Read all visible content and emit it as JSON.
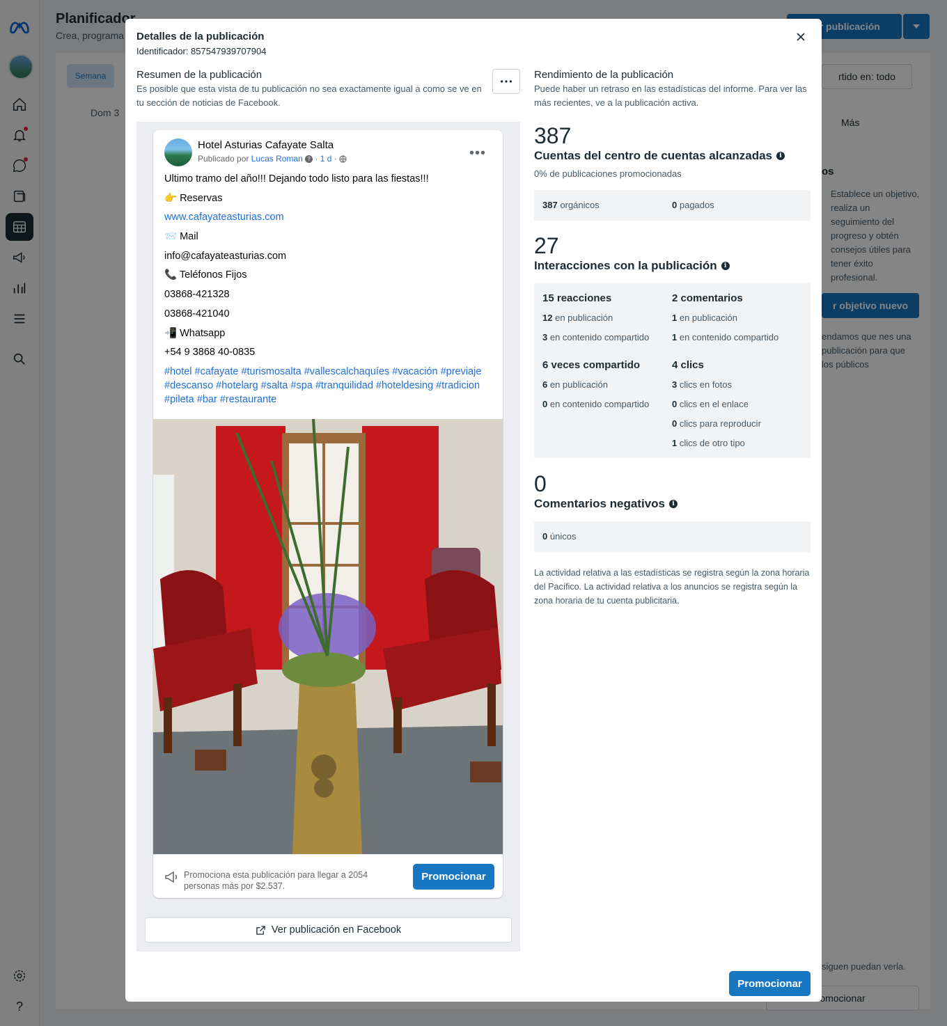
{
  "background": {
    "title": "Planificador",
    "subtitle": "Crea, programa",
    "create_button": "ear publicación",
    "week_button": "Semana",
    "day_label": "Dom 3",
    "filter_label": "rtido en: todo",
    "more_label": "Más",
    "goal_heading": "os",
    "goal_text": "Establece un objetivo, realiza un seguimiento del progreso y obtén consejos útiles para tener éxito profesional.",
    "goal_button": "r objetivo nuevo",
    "recommend_text": "endamos que nes una publicación para que los públicos",
    "side_bottom_text": "siguen puedan verla.",
    "side_bottom_button": "omocionar"
  },
  "modal": {
    "title": "Detalles de la publicación",
    "identifier": "Identificador: 857547939707904",
    "summary_title": "Resumen de la publicación",
    "summary_desc": "Es posible que esta vista de tu publicación no sea exactamente igual a como se ve en tu sección de noticias de Facebook.",
    "performance_title": "Rendimiento de la publicación",
    "performance_desc": "Puede haber un retraso en las estadísticas del informe. Para ver las más recientes, ve a la publicación activa.",
    "view_on_facebook": "Ver publicación en Facebook",
    "promote_button": "Promocionar"
  },
  "post": {
    "page_name": "Hotel Asturias Cafayate Salta",
    "published_by": "Publicado por",
    "author": "Lucas Roman",
    "time": "1 d",
    "lines": [
      "Ultimo tramo del año!!! Dejando todo listo para las fiestas!!!",
      "👉 Reservas",
      "www.cafayateasturias.com",
      "📨 Mail",
      "info@cafayateasturias.com",
      "📞 Teléfonos Fijos",
      "03868-421328",
      "03868-421040",
      "📲 Whatsapp",
      "+54 9 3868 40-0835"
    ],
    "hashtags": "#hotel #cafayate #turismosalta #vallescalchaquíes #vacación #previaje #descanso #hotelarg #salta #spa #tranquilidad #hoteldesing #tradicion #pileta #bar #restaurante",
    "promo_text": "Promociona esta publicación para llegar a 2054 personas más por $2.537.",
    "promo_button": "Promocionar"
  },
  "metrics": {
    "reach": {
      "value": "387",
      "label": "Cuentas del centro de cuentas alcanzadas",
      "promoted_note": "0% de publicaciones promocionadas",
      "organic_value": "387",
      "organic_label": "orgánicos",
      "paid_value": "0",
      "paid_label": "pagados"
    },
    "interactions": {
      "value": "27",
      "label": "Interacciones con la publicación",
      "reactions_title": "15 reacciones",
      "reactions_post_value": "12",
      "reactions_post_label": "en publicación",
      "reactions_shared_value": "3",
      "reactions_shared_label": "en contenido compartido",
      "comments_title": "2 comentarios",
      "comments_post_value": "1",
      "comments_post_label": "en publicación",
      "comments_shared_value": "1",
      "comments_shared_label": "en contenido compartido",
      "shares_title": "6 veces compartido",
      "shares_post_value": "6",
      "shares_post_label": "en publicación",
      "shares_shared_value": "0",
      "shares_shared_label": "en contenido compartido",
      "clicks_title": "4 clics",
      "clicks_photos_value": "3",
      "clicks_photos_label": "clics en fotos",
      "clicks_link_value": "0",
      "clicks_link_label": "clics en el enlace",
      "clicks_play_value": "0",
      "clicks_play_label": "clics para reproducir",
      "clicks_other_value": "1",
      "clicks_other_label": "clics de otro tipo"
    },
    "negative": {
      "value": "0",
      "label": "Comentarios negativos",
      "unique_value": "0",
      "unique_label": "únicos"
    },
    "footnote": "La actividad relativa a las estadísticas se registra según la zona horaria del Pacífico. La actividad relativa a los anuncios se registra según la zona horaria de tu cuenta publicitaria."
  },
  "colors": {
    "accent": "#1877c2",
    "link": "#216fdb"
  }
}
